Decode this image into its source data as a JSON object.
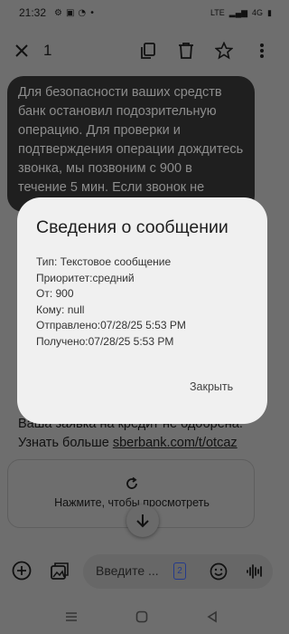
{
  "status_bar": {
    "time": "21:32",
    "network": "4G",
    "lte": "LTE"
  },
  "app_bar": {
    "selected_count": "1"
  },
  "messages": {
    "dark_bubble": "Для безопасности ваших средств банк остановил подозрительную операцию. Для проверки и подтверждения операции дождитесь звонка, мы позвоним с 900 в течение 5 мин. Если звонок не",
    "light_bubble_line1": "Ваша заявка на кредит не одобрена.",
    "light_bubble_prefix": "Узнать больше ",
    "light_bubble_link": "sberbank.com/t/otcaz",
    "mms_card_text": "Нажмите, чтобы просмотреть"
  },
  "composer": {
    "placeholder": "Введите ...",
    "sim_label": "2"
  },
  "dialog": {
    "title": "Сведения о сообщении",
    "rows": [
      "Тип: Текстовое сообщение",
      "Приоритет:средний",
      "От: 900",
      "Кому: null",
      "Отправлено:07/28/25 5:53 PM",
      "Получено:07/28/25 5:53 PM"
    ],
    "close_label": "Закрыть"
  },
  "colors": {
    "scrim": "#6e6e6e",
    "dialog_bg": "#f0f0f0",
    "dark_bubble": "#1f1f1f",
    "sim_accent": "#243a8c"
  },
  "icons": [
    "close-icon",
    "copy-icon",
    "delete-icon",
    "star-icon",
    "more-vert-icon",
    "add-icon",
    "gallery-icon",
    "emoji-icon",
    "voice-icon",
    "refresh-icon",
    "arrow-down-icon",
    "nav-menu-icon",
    "nav-home-icon",
    "nav-back-icon"
  ]
}
